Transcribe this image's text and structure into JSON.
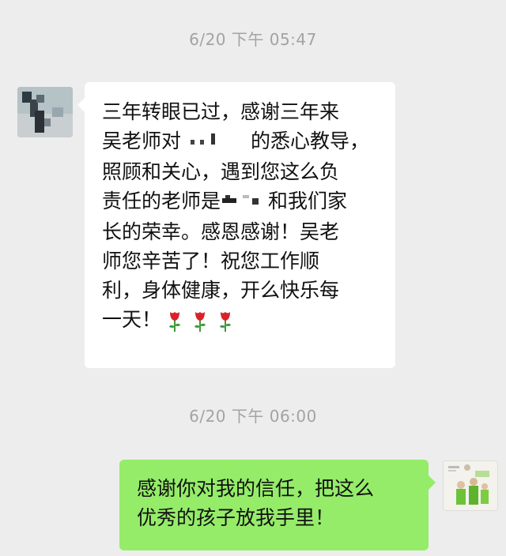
{
  "chat": {
    "timestamp_1": "6/20 下午 05:47",
    "timestamp_2": "6/20 下午 06:00",
    "incoming": {
      "lines": [
        "三年转眼已过，感谢三年来",
        "吴老师对",
        "的悉心教导，",
        "照顾和关心，遇到您这么负",
        "责任的老师是",
        "和我们家",
        "长的荣幸。感恩感谢！吴老",
        "师您辛苦了！祝您工作顺",
        "利，身体健康，开么快乐每",
        "一天！"
      ],
      "emoji": [
        "rose-emoji",
        "rose-emoji",
        "rose-emoji"
      ]
    },
    "outgoing": {
      "lines": [
        "感谢你对我的信任，把这么",
        "优秀的孩子放我手里！"
      ]
    }
  },
  "colors": {
    "background": "#ededed",
    "incoming_bubble": "#ffffff",
    "outgoing_bubble": "#95ec69",
    "timestamp_text": "#a3a3a3",
    "rose_red": "#d8232a",
    "rose_green": "#3c9a3a"
  },
  "icons": {
    "avatar_left": "blurred-photo-avatar",
    "avatar_right": "family-photo-avatar",
    "redaction": "pixelated-name"
  }
}
